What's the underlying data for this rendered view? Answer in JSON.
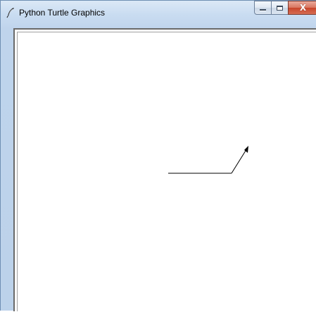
{
  "window": {
    "title": "Python Turtle Graphics",
    "app_icon": "feather-icon",
    "controls": {
      "minimize_icon": "minimize-icon",
      "maximize_icon": "maximize-icon",
      "close_icon": "close-icon",
      "close_glyph": "X"
    },
    "colors": {
      "titlebar": "#c9dcf1",
      "close_button": "#c8452b",
      "canvas": "#ffffff"
    }
  },
  "canvas": {
    "background": "#ffffff",
    "turtle": {
      "shape": "arrow",
      "pen_color": "#000000"
    }
  }
}
